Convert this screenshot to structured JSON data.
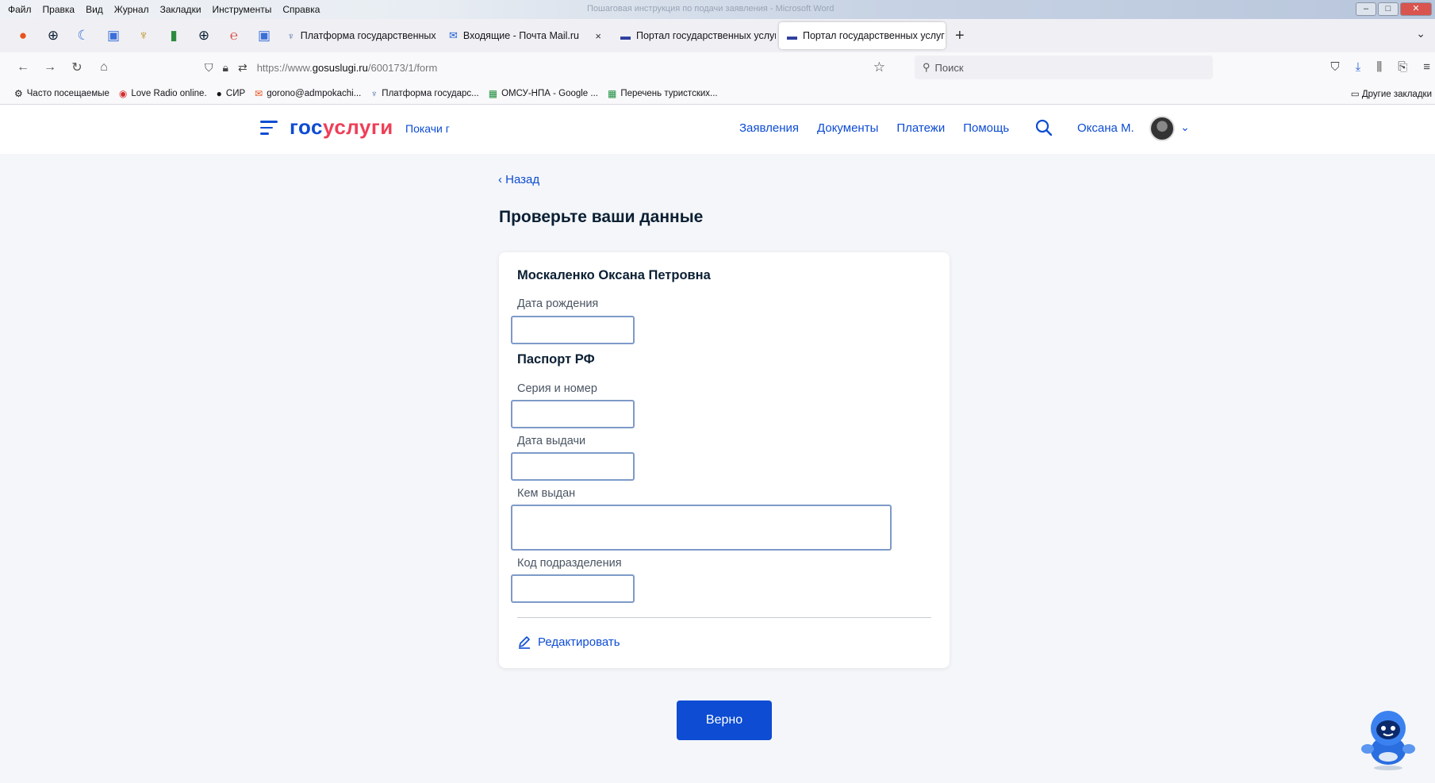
{
  "window": {
    "menu": [
      "Файл",
      "Правка",
      "Вид",
      "Журнал",
      "Закладки",
      "Инструменты",
      "Справка"
    ],
    "title": "Пошаговая инструкция по подачи заявления - Microsoft Word"
  },
  "browser": {
    "tabs": [
      {
        "label": "Платформа государственных",
        "close": "×"
      },
      {
        "label": "Входящие - Почта Mail.ru",
        "close": "×"
      },
      {
        "label": "Портал государственных услуг",
        "close": "×"
      },
      {
        "label": "Портал государственных услуг",
        "close": "×",
        "active": true
      }
    ],
    "new_tab": "+",
    "url_prefix": "https://www.",
    "url_host": "gosuslugi.ru",
    "url_path": "/600173/1/form",
    "search_placeholder": "Поиск",
    "bookmarks": [
      "Часто посещаемые",
      "Love Radio online.",
      "СИР",
      "gorono@admpokachi...",
      "Платформа государс...",
      "ОМСУ-НПА - Google ...",
      "Перечень туристских..."
    ],
    "other_bookmarks": "Другие закладки"
  },
  "header": {
    "logo_part1": "гос",
    "logo_part2": "услуги",
    "region": "Покачи г",
    "nav": [
      "Заявления",
      "Документы",
      "Платежи",
      "Помощь"
    ],
    "user": "Оксана М."
  },
  "form": {
    "back": "Назад",
    "title": "Проверьте ваши данные",
    "full_name": "Москаленко Оксана Петровна",
    "birth_date_label": "Дата рождения",
    "passport_section": "Паспорт РФ",
    "series_label": "Серия и номер",
    "issue_date_label": "Дата выдачи",
    "issued_by_label": "Кем выдан",
    "division_code_label": "Код подразделения",
    "edit_label": "Редактировать",
    "confirm_button": "Верно"
  },
  "colors": {
    "accent": "#0d4cd3",
    "logo_red": "#ee3f58",
    "page_bg": "#f4f6f9"
  }
}
